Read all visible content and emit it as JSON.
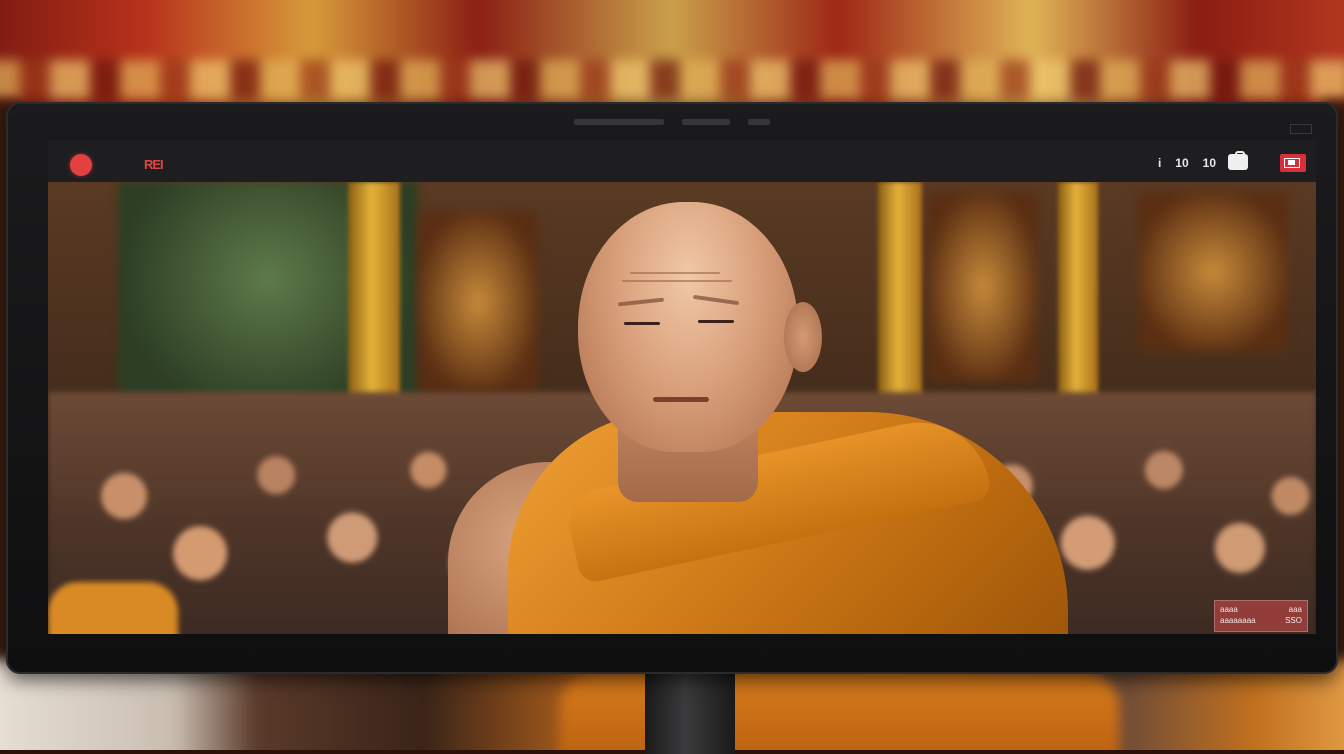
{
  "toolbar": {
    "recording_label": "REI",
    "right_items": [
      "i",
      "10",
      "10"
    ],
    "share_icon": "share-icon",
    "live_icon": "live-icon"
  },
  "viewport": {
    "watermark_line1": [
      "aaaa",
      "aaa"
    ],
    "watermark_line2": [
      "aaaaaaaa",
      "SSO"
    ]
  },
  "colors": {
    "record": "#e34140",
    "robe": "#d4801c",
    "toolbar": "#1e1e20"
  }
}
